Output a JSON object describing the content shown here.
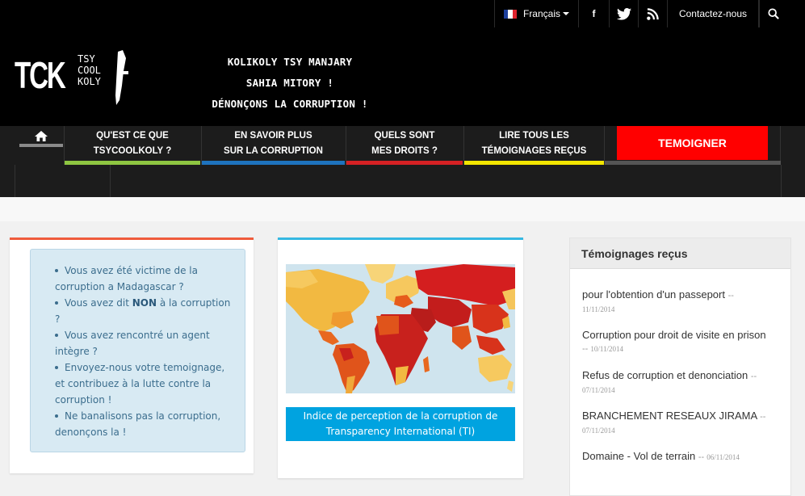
{
  "topbar": {
    "language_label": "Français",
    "facebook_glyph": "f",
    "contact_label": "Contactez-nous"
  },
  "header": {
    "logo_text": "TCK",
    "logo_sub": [
      "TSY",
      "COOL",
      "KOLY"
    ],
    "tagline": [
      "KOLIKOLY TSY MANJARY",
      "SAHIA MITORY !",
      "DÉNONÇONS LA CORRUPTION !"
    ]
  },
  "menu": {
    "items": [
      {
        "line1": "QU'EST CE QUE",
        "line2": "TSYCOOLKOLY ?",
        "color": "#8ec641"
      },
      {
        "line1": "EN SAVOIR PLUS",
        "line2": "SUR LA CORRUPTION",
        "color": "#1e73be"
      },
      {
        "line1": "QUELS SONT",
        "line2": "MES DROITS ?",
        "color": "#d62124"
      },
      {
        "line1": "LIRE TOUS LES",
        "line2": "TÉMOIGNAGES REÇUS",
        "color": "#f3e600"
      }
    ],
    "cta_label": "TEMOIGNER",
    "cta_color": "#ff0000"
  },
  "intro": {
    "bullets": [
      {
        "text": "Vous avez été victime de la corruption a Madagascar ?"
      },
      {
        "pre": "Vous avez dit ",
        "bold": "NON",
        "post": " à la corruption ?"
      },
      {
        "text": "Vous avez rencontré un agent intègre ?"
      },
      {
        "text": "Envoyez-nous votre temoignage, et contribuez à la lutte contre la corruption !"
      },
      {
        "text": "Ne banalisons pas la corruption, denonçons la !"
      }
    ]
  },
  "map_card": {
    "caption_line1": "Indice de perception de la corruption de",
    "caption_line2": "Transparency International (TI)"
  },
  "testimonies": {
    "title": "Témoignages reçus",
    "items": [
      {
        "title": "pour l'obtention d'un passeport",
        "date": "11/11/2014"
      },
      {
        "title": "Corruption pour droit de visite en prison",
        "date": "10/11/2014"
      },
      {
        "title": "Refus de corruption et denonciation",
        "date": "07/11/2014"
      },
      {
        "title": "BRANCHEMENT RESEAUX JIRAMA",
        "date": "07/11/2014"
      },
      {
        "title": "Domaine - Vol de terrain",
        "date": "06/11/2014"
      }
    ]
  }
}
